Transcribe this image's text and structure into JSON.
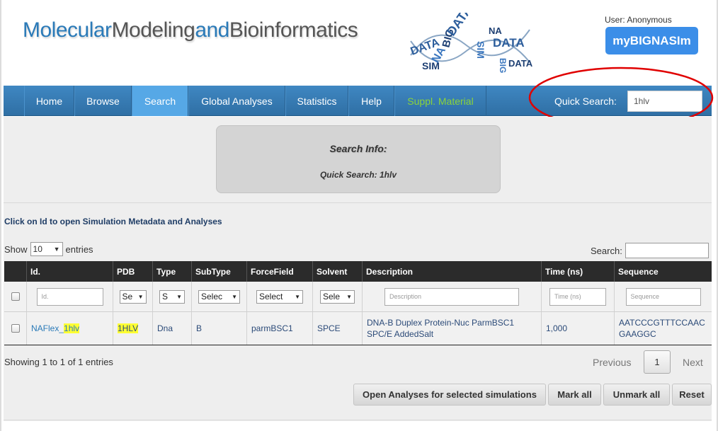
{
  "header": {
    "brand_part1": "Molecular",
    "brand_part2": "Modeling",
    "brand_part3": "and",
    "brand_part4": "Bioinformatics",
    "user_label": "User: Anonymous",
    "mybig_button": "myBIGNASIm"
  },
  "nav": {
    "items": [
      {
        "label": "Home"
      },
      {
        "label": "Browse"
      },
      {
        "label": "Search"
      },
      {
        "label": "Global Analyses"
      },
      {
        "label": "Statistics"
      },
      {
        "label": "Help"
      },
      {
        "label": "Suppl. Material"
      }
    ],
    "active": "Search",
    "quick_search_label": "Quick Search:",
    "quick_search_value": "1hlv"
  },
  "search_info": {
    "title": "Search Info:",
    "text": "Quick Search: 1hlv"
  },
  "click_info": "Click on Id to open Simulation Metadata and Analyses",
  "table_controls": {
    "show_label": "Show",
    "entries_value": "10",
    "entries_label": "entries",
    "search_label": "Search:"
  },
  "table": {
    "headers": [
      "",
      "Id.",
      "PDB",
      "Type",
      "SubType",
      "ForceField",
      "Solvent",
      "Description",
      "Time (ns)",
      "Sequence"
    ],
    "filters": {
      "id_placeholder": "Id.",
      "pdb_select": "Se",
      "type_select": "S",
      "subtype_select": "Selec",
      "forcefield_select": "Select",
      "solvent_select": "Sele",
      "description_placeholder": "Description",
      "time_placeholder": "Time (ns)",
      "sequence_placeholder": "Sequence"
    },
    "rows": [
      {
        "id_prefix": "NAFlex_",
        "id_match": "1hlv",
        "pdb": "1HLV",
        "type": "Dna",
        "subtype": "B",
        "forcefield": "parmBSC1",
        "solvent": "SPCE",
        "description_line1": "DNA-B Duplex Protein-Nuc ParmBSC1",
        "description_line2": "SPC/E AddedSalt",
        "time": "1,000",
        "sequence_line1": "AATCCCGTTTCCAAC",
        "sequence_line2": "GAAGGC"
      }
    ]
  },
  "pagination": {
    "showing": "Showing 1 to 1 of 1 entries",
    "previous": "Previous",
    "page": "1",
    "next": "Next"
  },
  "actions": {
    "open_analyses": "Open Analyses for selected simulations",
    "mark_all": "Mark all",
    "unmark_all": "Unmark all",
    "reset": "Reset"
  },
  "logo_words": [
    "DATA",
    "SIM",
    "NA",
    "BIG",
    "DATA",
    "SIM",
    "NA",
    "DATA",
    "BIG",
    "DATA"
  ],
  "colors": {
    "nav": "#3f87c2",
    "nav_active": "#56a8e6",
    "suppl": "#8bd43a",
    "mybig": "#3b8ee8",
    "highlight": "#ffff33",
    "annotation_circle": "#e00000"
  }
}
